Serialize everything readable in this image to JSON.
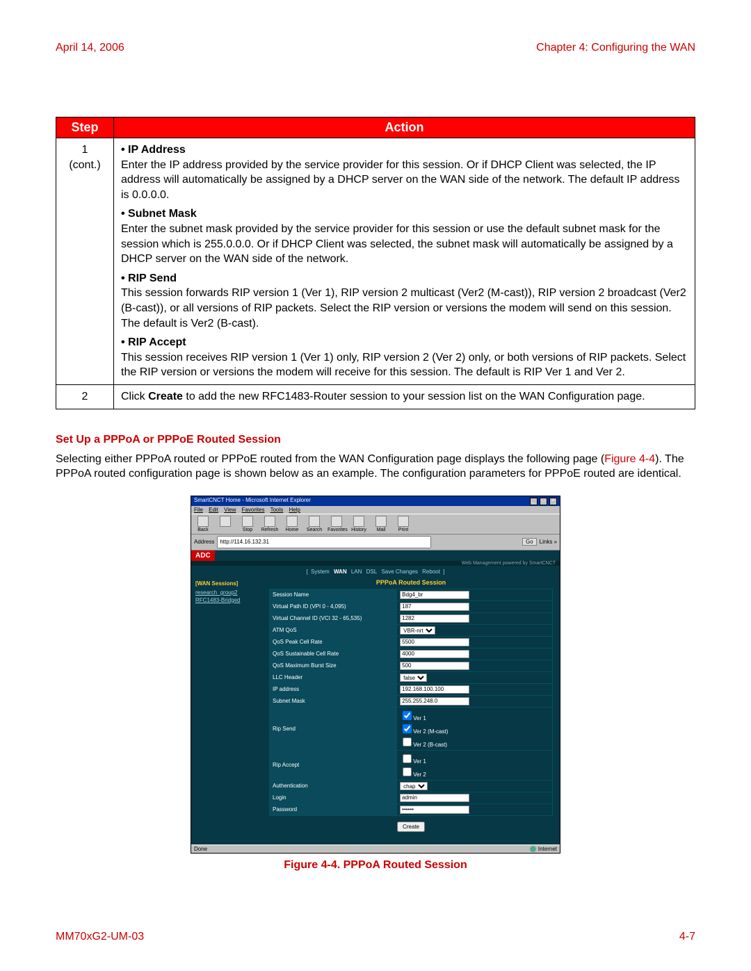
{
  "header": {
    "date": "April 14, 2006",
    "chapter": "Chapter 4: Configuring the WAN"
  },
  "table": {
    "head_step": "Step",
    "head_action": "Action",
    "row1_step_a": "1",
    "row1_step_b": "(cont.)",
    "row1": {
      "ip_head": "• IP Address",
      "ip_body": "Enter the IP address provided by the service provider for this session. Or if DHCP Client was selected, the IP address will automatically be assigned by a DHCP server on the WAN side of the network. The default IP address is 0.0.0.0.",
      "sm_head": "• Subnet Mask",
      "sm_body": "Enter the subnet mask provided by the service provider for this session or use the default subnet mask for the session which is 255.0.0.0. Or if DHCP Client was selected, the subnet mask will automatically be assigned by a DHCP server on the WAN side of the network.",
      "rs_head": "• RIP Send",
      "rs_body": "This session forwards RIP version 1 (Ver 1), RIP version 2 multicast (Ver2 (M-cast)), RIP version 2 broadcast (Ver2 (B-cast)), or all versions of RIP packets. Select the RIP version or versions the modem will send on this session. The default is Ver2 (B-cast).",
      "ra_head": "• RIP Accept",
      "ra_body": "This session receives RIP version 1 (Ver 1) only, RIP version 2 (Ver 2) only, or both versions of RIP packets. Select the RIP version or versions the modem will receive for this session. The default is RIP Ver 1 and Ver 2."
    },
    "row2_step": "2",
    "row2_pre": "Click ",
    "row2_bold": "Create",
    "row2_post": " to add the new RFC1483-Router session to your session list on the WAN Configuration page."
  },
  "section_title": "Set Up a PPPoA or PPPoE Routed Session",
  "para_pre": "Selecting either PPPoA routed or PPPoE routed from the WAN Configuration page displays the following page (",
  "para_figref": "Figure 4-4",
  "para_post": "). The PPPoA routed configuration page is shown below as an example. The configuration parameters for PPPoE routed are identical.",
  "browser": {
    "title": "SmartCNCT Home - Microsoft Internet Explorer",
    "menu": [
      "File",
      "Edit",
      "View",
      "Favorites",
      "Tools",
      "Help"
    ],
    "toolbar": [
      "Back",
      "",
      "Stop",
      "Refresh",
      "Home",
      "Search",
      "Favorites",
      "History",
      "Mail",
      "Print"
    ],
    "address_label": "Address",
    "address_value": "http://114.16.132.31",
    "go": "Go",
    "links": "Links »",
    "brand": "ADC",
    "wm": "Web Management powered by SmartCNCT",
    "nav": [
      "System",
      "WAN",
      "LAN",
      "DSL",
      "Save Changes",
      "Reboot"
    ],
    "sidebar_head": "[WAN Sessions]",
    "sidebar_items": [
      "research_group2",
      "RFC1483-Bridged"
    ],
    "panel_title": "PPPoA Routed Session",
    "rows": {
      "session_name": {
        "label": "Session Name",
        "value": "Bdg4_br"
      },
      "vpi": {
        "label": "Virtual Path ID    (VPI 0 - 4,095)",
        "value": "187"
      },
      "vci": {
        "label": "Virtual Channel ID    (VCI 32 - 65,535)",
        "value": "1282"
      },
      "atmqos": {
        "label": "ATM QoS",
        "value": "VBR-nrt"
      },
      "peak": {
        "label": "QoS Peak Cell Rate",
        "value": "5500"
      },
      "sust": {
        "label": "QoS Sustainable Cell Rate",
        "value": "4000"
      },
      "burst": {
        "label": "QoS Maximum Burst Size",
        "value": "500"
      },
      "llc": {
        "label": "LLC Header",
        "value": "false"
      },
      "ip": {
        "label": "IP address",
        "value": "192.168.100.100"
      },
      "mask": {
        "label": "Subnet Mask",
        "value": "255.255.248.0"
      },
      "ripsend": {
        "label": "Rip Send",
        "o1": "Ver 1",
        "o2": "Ver 2 (M-cast)",
        "o3": "Ver 2 (B-cast)"
      },
      "ripaccept": {
        "label": "Rip Accept",
        "o1": "Ver 1",
        "o2": "Ver 2"
      },
      "auth": {
        "label": "Authentication",
        "value": "chap"
      },
      "login": {
        "label": "Login",
        "value": "admin"
      },
      "pass": {
        "label": "Password",
        "value": "••••••"
      }
    },
    "create_btn": "Create",
    "status_left": "Done",
    "status_right": "Internet"
  },
  "fig_caption": "Figure 4-4. PPPoA Routed Session",
  "footer": {
    "left": "MM70xG2-UM-03",
    "right": "4-7"
  }
}
